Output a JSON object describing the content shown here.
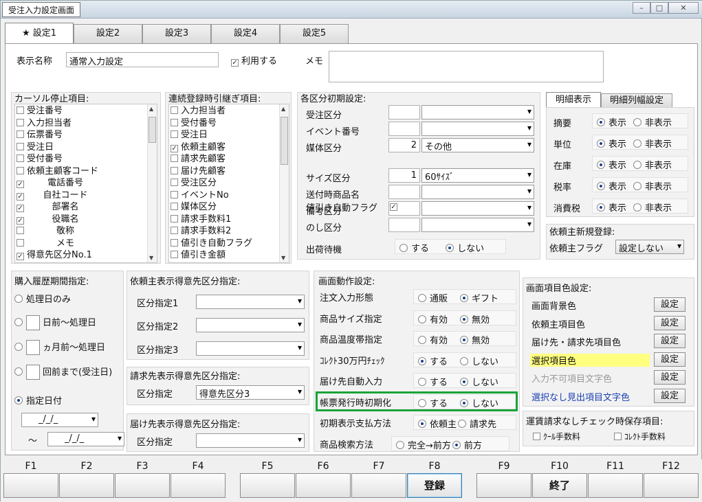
{
  "window": {
    "title": "受注入力設定画面",
    "min": "–",
    "max": "□",
    "close": "✕"
  },
  "tabs": [
    "★ 設定1",
    "設定2",
    "設定3",
    "設定4",
    "設定5"
  ],
  "top": {
    "display_name_label": "表示名称",
    "display_name_value": "通常入力設定",
    "use_label": "利用する",
    "memo_label": "メモ"
  },
  "cursor": {
    "title": "カーソル停止項目:",
    "items": [
      {
        "label": "受注番号",
        "checked": false
      },
      {
        "label": "入力担当者",
        "checked": false
      },
      {
        "label": "伝票番号",
        "checked": false
      },
      {
        "label": "受注日",
        "checked": false
      },
      {
        "label": "受付番号",
        "checked": false
      },
      {
        "label": "依頼主顧客コード",
        "checked": false
      },
      {
        "label": "電話番号",
        "checked": true,
        "indent": true
      },
      {
        "label": "自社コード",
        "checked": true,
        "indent": true
      },
      {
        "label": "部署名",
        "checked": true,
        "indent": true
      },
      {
        "label": "役職名",
        "checked": true,
        "indent": true
      },
      {
        "label": "敬称",
        "checked": false,
        "indent": true
      },
      {
        "label": "メモ",
        "checked": false,
        "indent": true
      },
      {
        "label": "得意先区分No.1",
        "checked": true
      }
    ]
  },
  "carry": {
    "title": "連続登録時引継ぎ項目:",
    "items": [
      {
        "label": "入力担当者",
        "checked": false
      },
      {
        "label": "受付番号",
        "checked": false
      },
      {
        "label": "受注日",
        "checked": false
      },
      {
        "label": "依頼主顧客",
        "checked": true
      },
      {
        "label": "請求先顧客",
        "checked": false
      },
      {
        "label": "届け先顧客",
        "checked": false
      },
      {
        "label": "受注区分",
        "checked": false
      },
      {
        "label": "イベントNo",
        "checked": false
      },
      {
        "label": "媒体区分",
        "checked": false
      },
      {
        "label": "請求手数料1",
        "checked": false
      },
      {
        "label": "請求手数料2",
        "checked": false
      },
      {
        "label": "値引き自動フラグ",
        "checked": false
      },
      {
        "label": "値引き金額",
        "checked": false
      }
    ]
  },
  "initial": {
    "title": "各区分初期設定:",
    "rows": [
      {
        "label": "受注区分",
        "num": "",
        "select": ""
      },
      {
        "label": "イベント番号",
        "num": "",
        "select": ""
      },
      {
        "label": "媒体区分",
        "num": "2",
        "select": "その他"
      },
      {
        "label": "サイズ区分",
        "num": "1",
        "select": "60ｻｲｽﾞ"
      },
      {
        "label": "送付時商品名",
        "num": "",
        "select": ""
      },
      {
        "label": "備考区分",
        "num": "",
        "select": ""
      },
      {
        "label": "のし区分",
        "num": "",
        "select": ""
      }
    ],
    "discount_label": "値引き自動フラグ",
    "discount_checked": true,
    "shipwait_label": "出荷待機",
    "opt_yes": "する",
    "opt_no": "しない",
    "shipwait_value": "しない"
  },
  "detail": {
    "tab1": "明細表示",
    "tab2": "明細列幅設定",
    "show": "表示",
    "hide": "非表示",
    "rows": [
      {
        "label": "摘要",
        "value": "表示"
      },
      {
        "label": "単位",
        "value": "表示"
      },
      {
        "label": "在庫",
        "value": "表示"
      },
      {
        "label": "税率",
        "value": "表示"
      },
      {
        "label": "消費税",
        "value": "表示"
      }
    ]
  },
  "newclient": {
    "title": "依頼主新規登録:",
    "flag_label": "依頼主フラグ",
    "flag_value": "設定しない"
  },
  "history": {
    "title": "購入履歴期間指定:",
    "o1": "処理日のみ",
    "o2": "日前～処理日",
    "o3": "ヵ月前～処理日",
    "o4": "回前まで(受注日)",
    "o5": "指定日付",
    "d1": "_/_/_",
    "tilde": "～",
    "d2": "_/_/_",
    "value": "指定日付"
  },
  "clientcls": {
    "title": "依頼主表示得意先区分指定:",
    "l1": "区分指定1",
    "l2": "区分指定2",
    "l3": "区分指定3"
  },
  "billcls": {
    "title": "請求先表示得意先区分指定:",
    "l1": "区分指定",
    "v1": "得意先区分3"
  },
  "delivcls": {
    "title": "届け先表示得意先区分指定:",
    "l1": "区分指定"
  },
  "behavior": {
    "title": "画面動作設定:",
    "rows": [
      {
        "label": "注文入力形態",
        "a": "通販",
        "b": "ギフト",
        "value": "b"
      },
      {
        "label": "商品サイズ指定",
        "a": "有効",
        "b": "無効",
        "value": "b"
      },
      {
        "label": "商品温度帯指定",
        "a": "有効",
        "b": "無効",
        "value": "b"
      },
      {
        "label": "ｺﾚｸﾄ30万円ﾁｪｯｸ",
        "a": "する",
        "b": "しない",
        "value": "a"
      },
      {
        "label": "届け先自動入力",
        "a": "する",
        "b": "しない",
        "value": "b"
      },
      {
        "label": "帳票発行時初期化",
        "a": "する",
        "b": "しない",
        "value": "b"
      },
      {
        "label": "初期表示支払方法",
        "a": "依頼主",
        "b": "請求先",
        "value": "a"
      },
      {
        "label": "商品検索方法",
        "a": "完全→前方",
        "b": "前方",
        "value": "b"
      }
    ],
    "highlight_color": "#1aa33a"
  },
  "colors": {
    "title": "画面項目色設定:",
    "btn": "設定",
    "rows": [
      {
        "label": "画面背景色",
        "style": "normal"
      },
      {
        "label": "依頼主項目色",
        "style": "normal"
      },
      {
        "label": "届け先・請求先項目色",
        "style": "normal"
      },
      {
        "label": "選択項目色",
        "style": "yellow"
      },
      {
        "label": "入力不可項目文字色",
        "style": "gray"
      },
      {
        "label": "選択なし見出項目文字色",
        "style": "blue"
      }
    ],
    "yellow": "#ffff80",
    "blue": "#1a3fb0"
  },
  "freight": {
    "title": "運賃請求なしチェック時保存項目:",
    "c1": "ｸｰﾙ手数料",
    "c2": "ｺﾚｸﾄ手数料"
  },
  "fkeys": [
    {
      "k": "F1",
      "t": ""
    },
    {
      "k": "F2",
      "t": ""
    },
    {
      "k": "F3",
      "t": ""
    },
    {
      "k": "F4",
      "t": ""
    },
    {
      "k": "F5",
      "t": ""
    },
    {
      "k": "F6",
      "t": ""
    },
    {
      "k": "F7",
      "t": ""
    },
    {
      "k": "F8",
      "t": "登録"
    },
    {
      "k": "F9",
      "t": ""
    },
    {
      "k": "F10",
      "t": "終了"
    },
    {
      "k": "F11",
      "t": ""
    },
    {
      "k": "F12",
      "t": ""
    }
  ]
}
